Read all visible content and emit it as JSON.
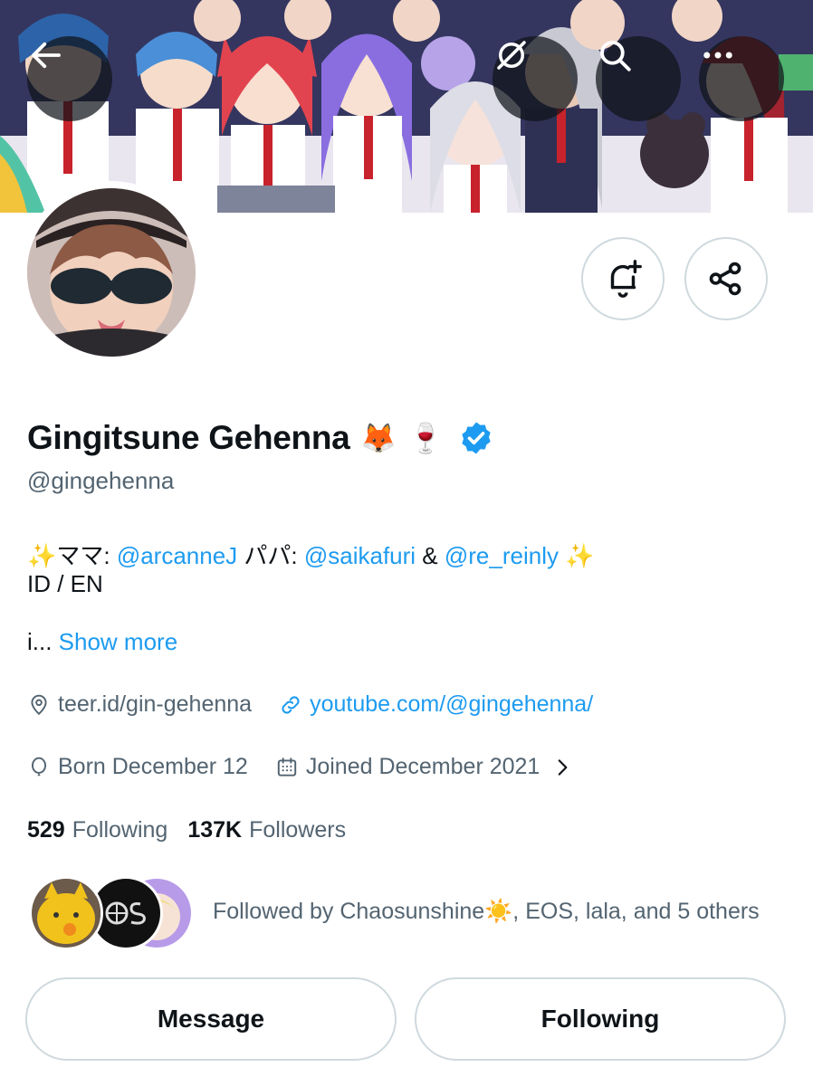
{
  "profile": {
    "display_name": "Gingitsune Gehenna",
    "name_emojis": [
      "🦊",
      "🍷"
    ],
    "handle": "@gingehenna",
    "verified": true
  },
  "top_bar": {
    "back_icon": "arrow-left-icon",
    "grok_icon": "grok-icon",
    "search_icon": "search-icon",
    "more_icon": "more-horizontal-icon"
  },
  "actions": {
    "notify_icon": "bell-plus-icon",
    "share_icon": "share-icon"
  },
  "bio": {
    "sparkle_start": "✨",
    "mama_label": "ママ: ",
    "mama_link": "@arcanneJ",
    "papa_label": " パパ: ",
    "papa_link": "@saikafuri",
    "and_text": " & ",
    "papa_link2": "@re_reinly",
    "sparkle_end": " ✨",
    "line2": "ID / EN",
    "truncated": "i... ",
    "show_more": "Show more"
  },
  "meta": {
    "location": "teer.id/gin-gehenna",
    "website": "youtube.com/@gingehenna/",
    "birthday": "Born December 12",
    "joined": "Joined December 2021"
  },
  "stats": {
    "following_count": "529",
    "following_label": "Following",
    "followers_count": "137K",
    "followers_label": "Followers"
  },
  "followed_by": {
    "text": "Followed by Chaosunshine☀️, EOS, lala, and 5 others"
  },
  "buttons": {
    "message": "Message",
    "following": "Following"
  },
  "colors": {
    "link": "#1d9bf0",
    "secondary_text": "#536471",
    "border": "#cfd9de",
    "verified": "#1d9bf0"
  }
}
